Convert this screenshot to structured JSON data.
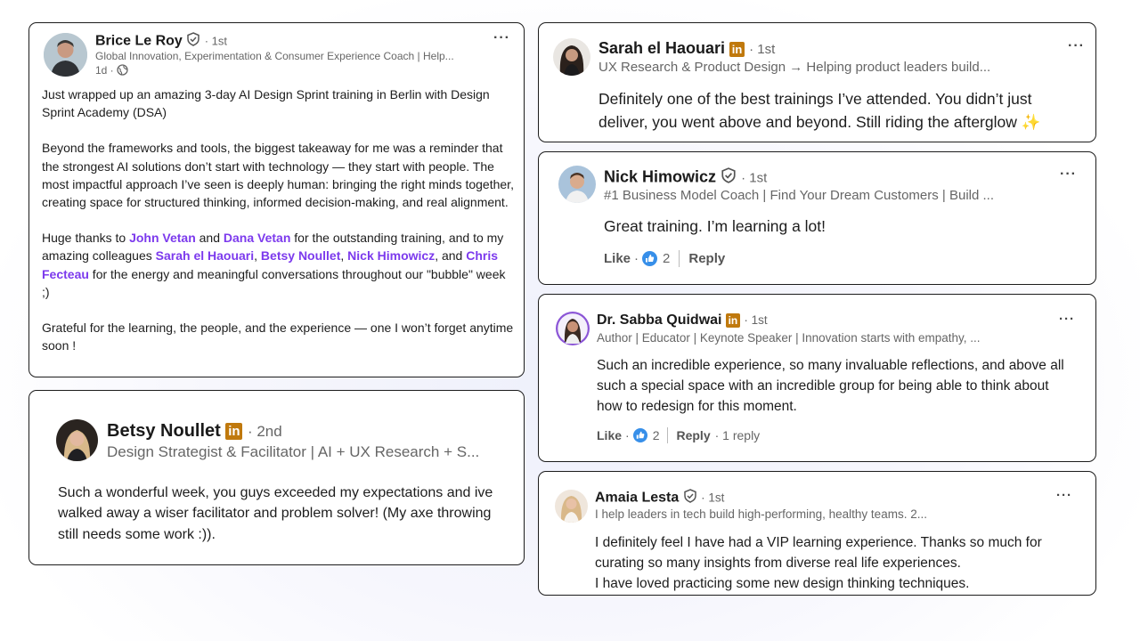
{
  "post": {
    "author_name": "Brice Le Roy",
    "degree": "· 1st",
    "headline": "Global Innovation, Experimentation & Consumer Experience Coach | Help...",
    "time": "1d ·",
    "para1": "Just wrapped up an amazing 3-day AI Design Sprint training in Berlin with Design Sprint Academy (DSA)",
    "para2": "Beyond the frameworks and tools, the biggest takeaway for me was a reminder that the strongest AI solutions don’t start with technology — they start with people. The most impactful approach I’ve seen is deeply human: bringing the right minds together, creating space for structured thinking, informed decision-making, and real alignment.",
    "para3_a": "Huge thanks to ",
    "mention_1": "John Vetan",
    "para3_b": " and ",
    "mention_2": "Dana Vetan",
    "para3_c": " for the outstanding training, and to my amazing colleagues ",
    "mention_3": "Sarah el Haouari",
    "para3_d": ", ",
    "mention_4": "Betsy Noullet",
    "para3_e": ", ",
    "mention_5": "Nick Himowicz",
    "para3_f": ", and ",
    "mention_6": "Chris Fecteau",
    "para3_g": " for the energy and meaningful conversations throughout our \"bubble\" week ;)",
    "para4": "Grateful for the learning, the people, and the experience — one I won’t forget anytime soon !"
  },
  "comments": {
    "betsy": {
      "name": "Betsy Noullet",
      "degree": "· 2nd",
      "headline": "Design Strategist & Facilitator | AI + UX Research + S...",
      "text": "Such a wonderful week, you guys exceeded my expectations and ive walked away a wiser facilitator and problem solver! (My axe throwing still needs some work :))."
    },
    "sarah": {
      "name": "Sarah el Haouari",
      "degree": "· 1st",
      "headline": "UX Research & Product Design → Helping product leaders build...",
      "text": "Definitely one of the best trainings I’ve attended. You didn’t just deliver, you went above and beyond. Still riding the afterglow",
      "emoji": "✨"
    },
    "nick": {
      "name": "Nick Himowicz",
      "degree": "· 1st",
      "headline": "#1 Business Model Coach | Find Your Dream Customers | Build ...",
      "text": "Great training. I’m learning a lot!",
      "like_label": "Like",
      "dot": "·",
      "like_count": "2",
      "reply_label": "Reply"
    },
    "sabba": {
      "name": "Dr. Sabba Quidwai",
      "degree": "· 1st",
      "headline": "Author | Educator | Keynote Speaker | Innovation starts with empathy, ...",
      "text": "Such an incredible experience, so many invaluable reflections, and above all such a special space with an incredible group for being able to think about how to redesign for this moment.",
      "like_label": "Like",
      "dot": "·",
      "like_count": "2",
      "reply_label": "Reply",
      "reply_count": "· 1 reply"
    },
    "amaia": {
      "name": "Amaia Lesta",
      "degree": "· 1st",
      "headline": "I help leaders in tech build high-performing, healthy teams. 2...",
      "text_line1": "I definitely feel I have had a VIP learning experience. Thanks so much for curating so many insights from diverse real life experiences.",
      "text_line2": "I have loved practicing some new design thinking techniques."
    }
  },
  "ui": {
    "more": "···",
    "in_badge": "in"
  },
  "colors": {
    "mention": "#7c3aed",
    "linkedin_badge": "#c0790d",
    "like_blue": "#378fe9"
  }
}
